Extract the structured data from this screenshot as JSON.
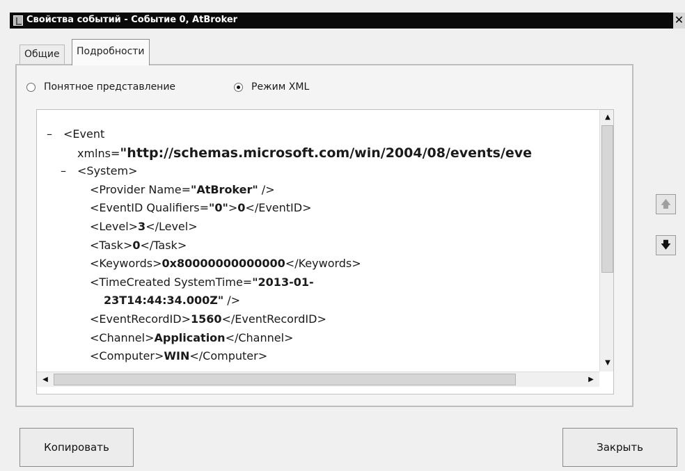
{
  "window": {
    "title": "Свойства событий - Событие 0, AtBroker",
    "close_glyph": "✕"
  },
  "tabs": [
    {
      "label": "Общие",
      "active": false
    },
    {
      "label": "Подробности",
      "active": true
    }
  ],
  "view_mode": {
    "options": [
      {
        "label": "Понятное представление",
        "checked": false
      },
      {
        "label": "Режим XML",
        "checked": true
      }
    ]
  },
  "xml": {
    "l0": {
      "toggle": "–",
      "text": "<Event"
    },
    "l1": {
      "attr": "xmlns=",
      "value": "\"http://schemas.microsoft.com/win/2004/08/events/eve"
    },
    "l2": {
      "toggle": "–",
      "text": "<System>"
    },
    "l3": {
      "pre": "<Provider Name=",
      "val": "\"AtBroker\"",
      "post": " />"
    },
    "l4": {
      "pre": "<EventID Qualifiers=",
      "val": "\"0\"",
      "mid": ">",
      "val2": "0",
      "post": "</EventID>"
    },
    "l5": {
      "pre": "<Level>",
      "val": "3",
      "post": "</Level>"
    },
    "l6": {
      "pre": "<Task>",
      "val": "0",
      "post": "</Task>"
    },
    "l7": {
      "pre": "<Keywords>",
      "val": "0x80000000000000",
      "post": "</Keywords>"
    },
    "l8": {
      "pre": "<TimeCreated SystemTime=",
      "val": "\"2013-01-"
    },
    "l9": {
      "val": "23T14:44:34.000Z\"",
      "post": " />"
    },
    "l10": {
      "pre": "<EventRecordID>",
      "val": "1560",
      "post": "</EventRecordID>"
    },
    "l11": {
      "pre": "<Channel>",
      "val": "Application",
      "post": "</Channel>"
    },
    "l12": {
      "pre": "<Computer>",
      "val": "WIN",
      "post": "</Computer>"
    }
  },
  "scrollbars": {
    "up": "▲",
    "down": "▼",
    "left": "◀",
    "right": "▶"
  },
  "nav": {
    "up_glyph": "🡅",
    "down_glyph": "🡇"
  },
  "buttons": {
    "copy_label": "Копировать",
    "close_label": "Закрыть"
  }
}
